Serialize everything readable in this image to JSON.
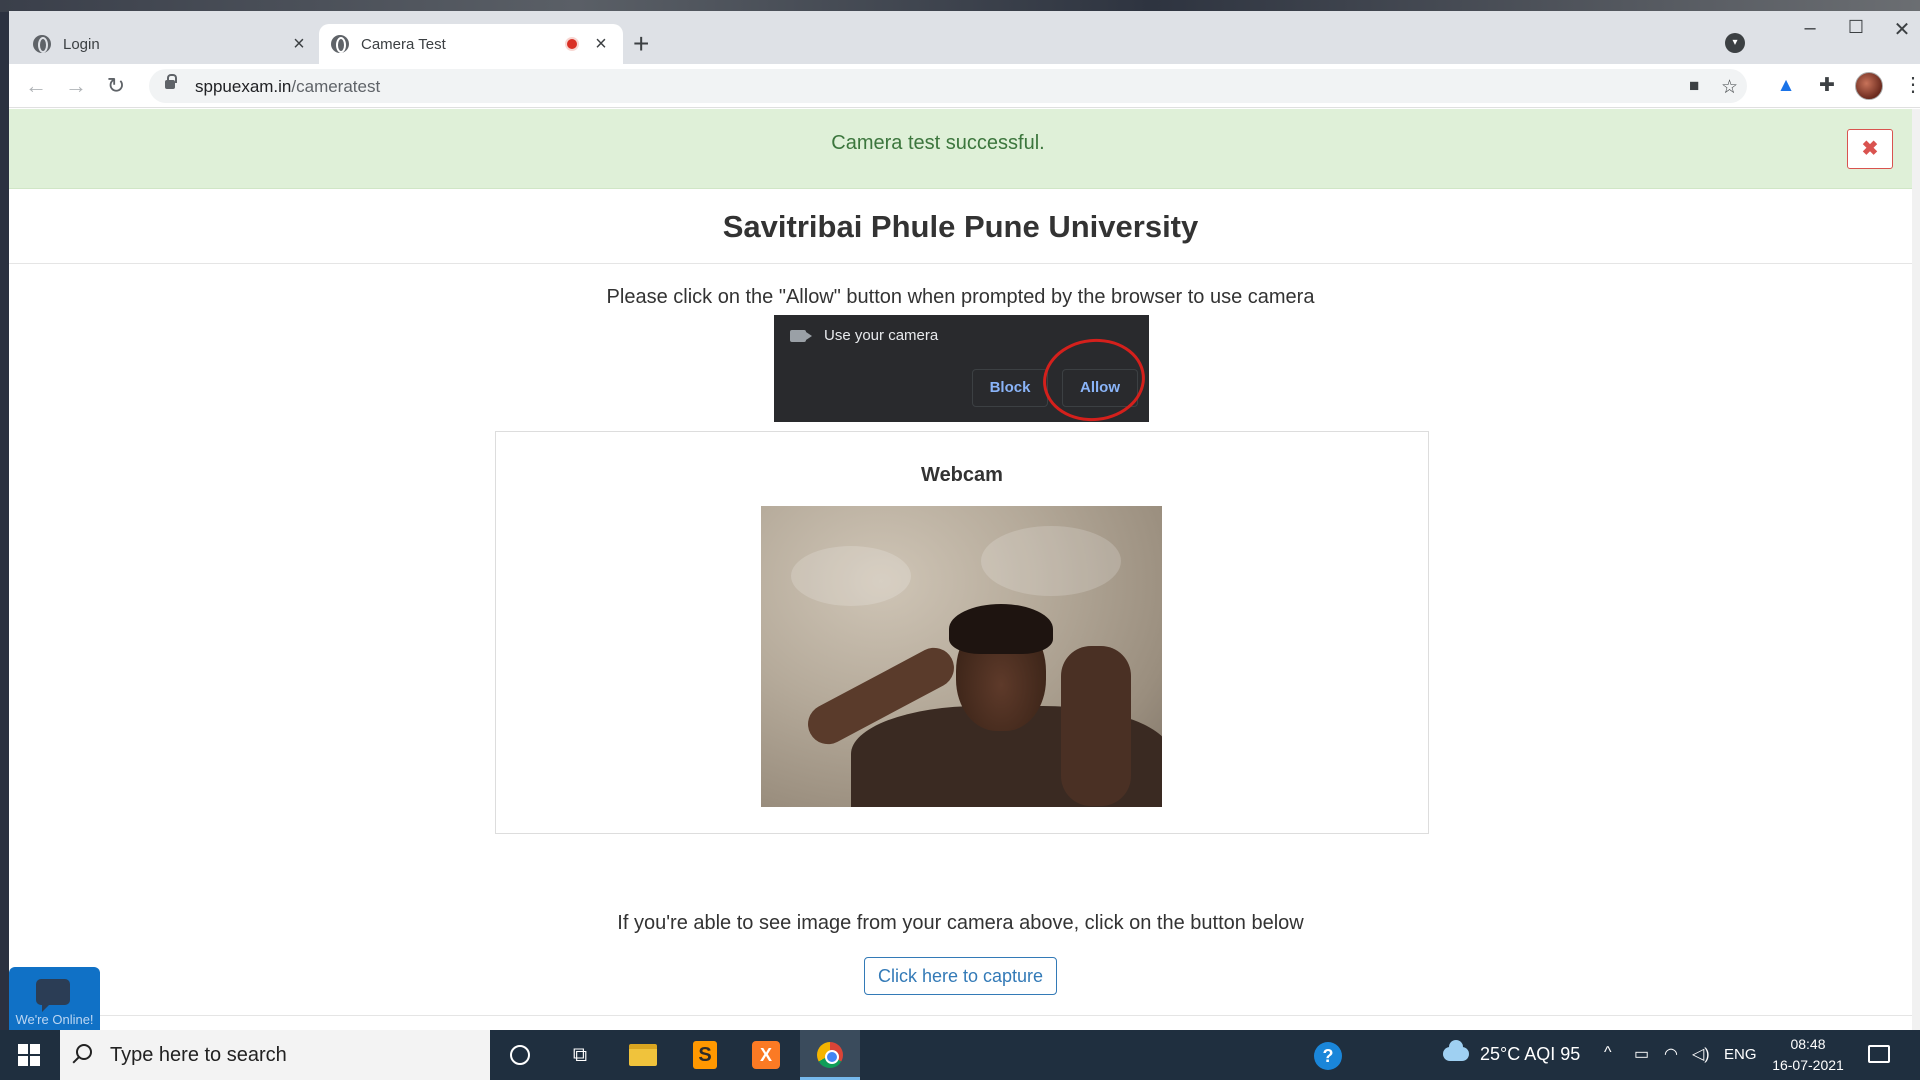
{
  "browser": {
    "tabs": [
      {
        "title": "Login",
        "active": false
      },
      {
        "title": "Camera Test",
        "active": true,
        "recording": true
      }
    ],
    "new_tab_glyph": "+",
    "url_domain": "sppuexam.in",
    "url_path": "/cameratest",
    "window_controls": {
      "minimize": "–",
      "maximize": "☐",
      "close": "✕"
    }
  },
  "alert": {
    "message": "Camera test successful.",
    "close_glyph": "✖",
    "color": "#3c763d"
  },
  "page": {
    "heading": "Savitribai Phule Pune University",
    "instruction": "Please click on the \"Allow\" button when prompted by the browser to use camera",
    "permission_prompt": {
      "title": "Use your camera",
      "block_label": "Block",
      "allow_label": "Allow"
    },
    "webcam_panel": {
      "title": "Webcam"
    },
    "hint": "If you're able to see image from your camera above, click on the button below",
    "capture_button": "Click here to capture",
    "chat_widget_text": "We're Online!"
  },
  "taskbar": {
    "search_placeholder": "Type here to search",
    "weather": "25°C  AQI 95",
    "language": "ENG",
    "time": "08:48",
    "date": "16-07-2021"
  },
  "colors": {
    "accent": "#337ab7",
    "alert_bg": "#dff0d8",
    "danger": "#d9534f",
    "taskbar": "#1f2f3f"
  }
}
